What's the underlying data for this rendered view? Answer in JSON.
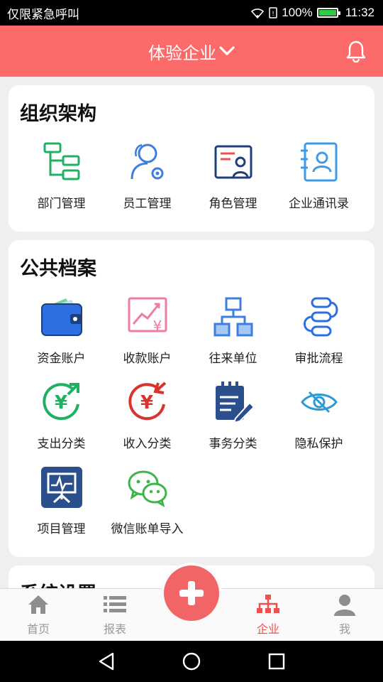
{
  "status_bar": {
    "carrier": "仅限紧急呼叫",
    "battery": "100%",
    "time": "11:32"
  },
  "header": {
    "title": "体验企业"
  },
  "sections": [
    {
      "title": "组织架构",
      "items": [
        {
          "label": "部门管理",
          "icon": "org-chart-icon"
        },
        {
          "label": "员工管理",
          "icon": "staff-settings-icon"
        },
        {
          "label": "角色管理",
          "icon": "role-card-icon"
        },
        {
          "label": "企业通讯录",
          "icon": "address-book-icon"
        }
      ]
    },
    {
      "title": "公共档案",
      "items": [
        {
          "label": "资金账户",
          "icon": "wallet-icon"
        },
        {
          "label": "收款账户",
          "icon": "income-chart-icon"
        },
        {
          "label": "往来单位",
          "icon": "hierarchy-icon"
        },
        {
          "label": "审批流程",
          "icon": "approval-flow-icon"
        },
        {
          "label": "支出分类",
          "icon": "expense-category-icon"
        },
        {
          "label": "收入分类",
          "icon": "income-category-icon"
        },
        {
          "label": "事务分类",
          "icon": "notepad-pen-icon"
        },
        {
          "label": "隐私保护",
          "icon": "eye-hidden-icon"
        },
        {
          "label": "项目管理",
          "icon": "presentation-board-icon"
        },
        {
          "label": "微信账单导入",
          "icon": "wechat-icon"
        }
      ]
    },
    {
      "title": "系统设置"
    }
  ],
  "tabs": [
    {
      "label": "首页",
      "icon": "home-icon"
    },
    {
      "label": "报表",
      "icon": "list-icon"
    },
    {
      "label": "企业",
      "icon": "enterprise-icon",
      "active": true
    },
    {
      "label": "我",
      "icon": "user-icon"
    }
  ],
  "colors": {
    "accent": "#fc6a6a",
    "active_tab": "#f0514c",
    "green": "#20b062",
    "blue": "#3d7fe0",
    "red": "#d9342b"
  }
}
